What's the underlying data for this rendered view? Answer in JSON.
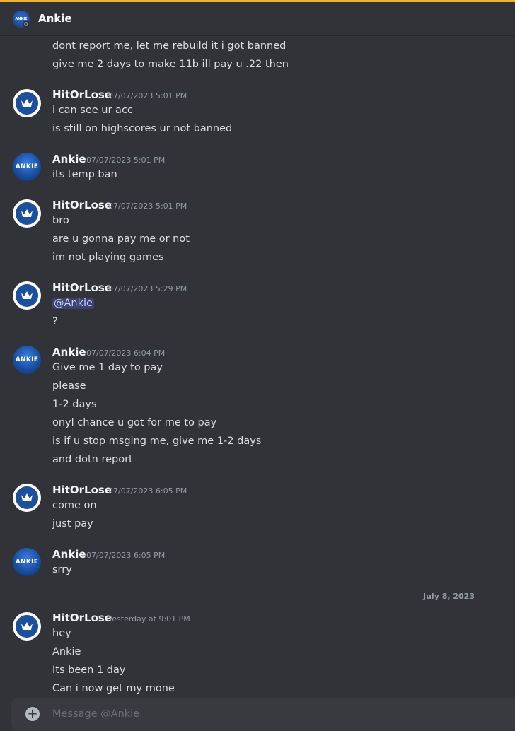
{
  "header": {
    "title": "Ankie",
    "avatar_text": "ANKIE"
  },
  "messages": {
    "cont_lines": [
      "dont report me, let me rebuild it i got banned",
      "give me 2 days to make 11b ill pay u .22 then"
    ],
    "g1": {
      "author": "HitOrLose",
      "time": "07/07/2023 5:01 PM",
      "lines": [
        "i can see ur acc",
        "is still on highscores ur not banned"
      ]
    },
    "g2": {
      "author": "Ankie",
      "time": "07/07/2023 5:01 PM",
      "avatar_text": "ANKIE",
      "lines": [
        "its temp ban"
      ]
    },
    "g3": {
      "author": "HitOrLose",
      "time": "07/07/2023 5:01 PM",
      "lines": [
        "bro",
        "are u gonna pay me or not",
        "im not playing games"
      ]
    },
    "g4": {
      "author": "HitOrLose",
      "time": "07/07/2023 5:29 PM",
      "mention": "@Ankie",
      "lines": [
        "?"
      ]
    },
    "g5": {
      "author": "Ankie",
      "time": "07/07/2023 6:04 PM",
      "avatar_text": "ANKIE",
      "lines": [
        "Give me 1 day to pay",
        "please",
        "1-2 days",
        "onyl chance u got for me to pay",
        "is if u stop msging me, give me 1-2 days",
        "and dotn report"
      ]
    },
    "g6": {
      "author": "HitOrLose",
      "time": "07/07/2023 6:05 PM",
      "lines": [
        "come on",
        "just pay"
      ]
    },
    "g7": {
      "author": "Ankie",
      "time": "07/07/2023 6:05 PM",
      "avatar_text": "ANKIE",
      "lines": [
        "srry"
      ]
    },
    "divider": "July 8, 2023",
    "g8": {
      "author": "HitOrLose",
      "time": "Yesterday at 9:01 PM",
      "lines": [
        "hey",
        "Ankie",
        "Its been 1 day",
        "Can i now get my mone"
      ]
    }
  },
  "composer": {
    "placeholder": "Message @Ankie"
  }
}
